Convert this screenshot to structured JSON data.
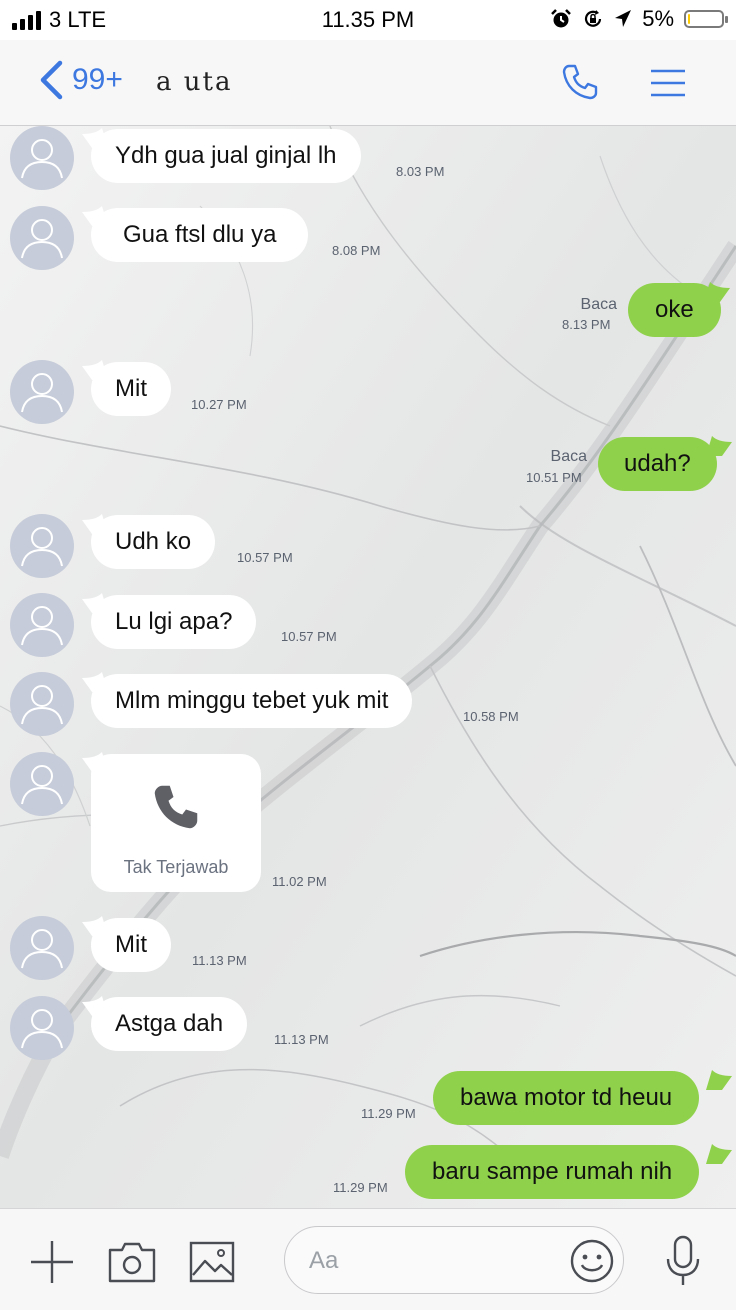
{
  "status_bar": {
    "carrier": "3 LTE",
    "time": "11.35 PM",
    "battery": "5%",
    "battery_level": 0.05,
    "icons": [
      "signal-icon",
      "alarm-icon",
      "rotation-lock-icon",
      "location-arrow-icon",
      "battery-icon"
    ]
  },
  "header": {
    "back_count": "99+",
    "title": "a uta",
    "icons": [
      "back-chevron-icon",
      "phone-icon",
      "menu-icon"
    ],
    "accent_color": "#3d78e0"
  },
  "messages": [
    {
      "direction": "in",
      "text": "Ydh gua jual ginjal lh",
      "time": "8.03 PM"
    },
    {
      "direction": "in",
      "text": "Gua ftsl dlu ya",
      "time": "8.08 PM"
    },
    {
      "direction": "out",
      "text": "oke",
      "status": "Baca",
      "time": "8.13 PM"
    },
    {
      "direction": "in",
      "text": "Mit",
      "time": "10.27 PM"
    },
    {
      "direction": "out",
      "text": "udah?",
      "status": "Baca",
      "time": "10.51 PM"
    },
    {
      "direction": "in",
      "text": "Udh ko",
      "time": "10.57 PM"
    },
    {
      "direction": "in",
      "text": "Lu lgi apa?",
      "time": "10.57 PM"
    },
    {
      "direction": "in",
      "text": "Mlm minggu tebet yuk mit",
      "time": "10.58 PM"
    },
    {
      "direction": "in",
      "type": "call",
      "text": "Tak Terjawab",
      "icon": "phone-icon",
      "time": "11.02 PM"
    },
    {
      "direction": "in",
      "text": "Mit",
      "time": "11.13 PM"
    },
    {
      "direction": "in",
      "text": "Astga dah",
      "time": "11.13 PM"
    },
    {
      "direction": "out",
      "text": "bawa motor td heuu",
      "time": "11.29 PM"
    },
    {
      "direction": "out",
      "text": "baru sampe rumah nih",
      "time": "11.29 PM"
    }
  ],
  "composer": {
    "placeholder": "Aa",
    "icons": [
      "plus-icon",
      "camera-icon",
      "image-icon",
      "emoji-icon",
      "microphone-icon"
    ]
  },
  "colors": {
    "outgoing_bubble": "#8fd14b",
    "incoming_bubble": "#ffffff",
    "avatar": "#c6ccd9"
  }
}
